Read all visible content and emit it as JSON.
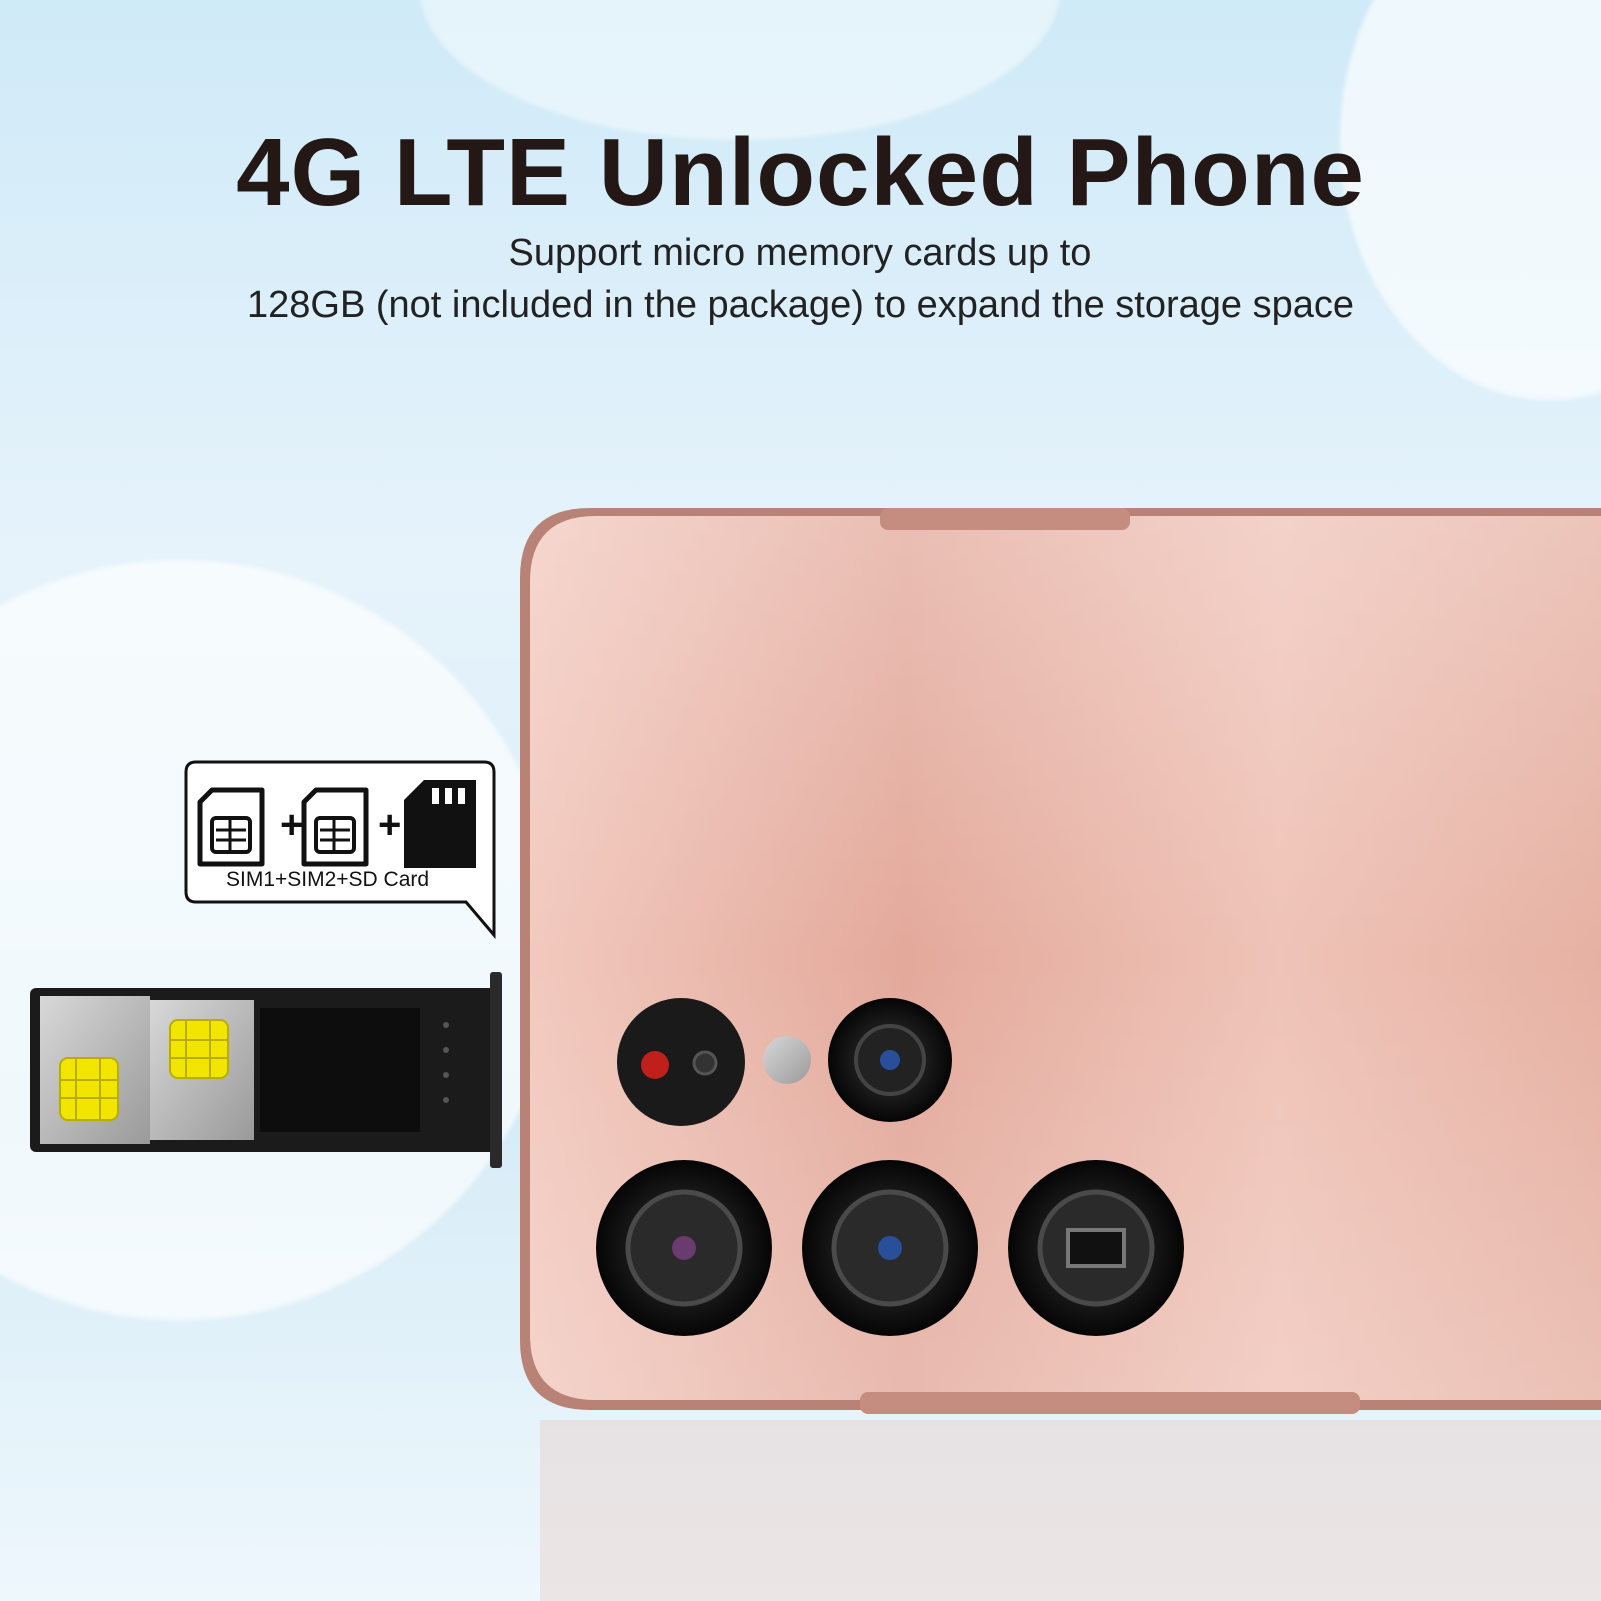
{
  "headline": "4G LTE Unlocked Phone",
  "subtitle_line1": "Support micro memory cards up to",
  "subtitle_line2": "128GB (not included in the package) to expand the storage space",
  "callout": {
    "label": "SIM1+SIM2+SD Card"
  },
  "colors": {
    "phone_body": "#e3a99b",
    "text_dark": "#231815",
    "sim_chip": "#f2e600",
    "tray": "#1b1b1b"
  },
  "icons": [
    "sim-card-icon",
    "sim-card-icon",
    "sd-card-icon",
    "plus-icon"
  ]
}
